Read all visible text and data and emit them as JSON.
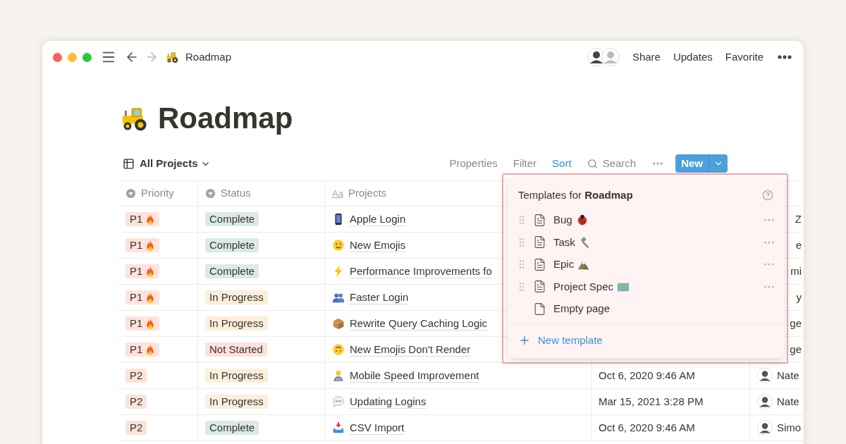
{
  "titlebar": {
    "breadcrumb": "Roadmap",
    "actions": [
      "Share",
      "Updates",
      "Favorite"
    ]
  },
  "page": {
    "title": "Roadmap"
  },
  "view": {
    "name": "All Projects",
    "tools": [
      {
        "label": "Properties",
        "selected": false
      },
      {
        "label": "Filter",
        "selected": false
      },
      {
        "label": "Sort",
        "selected": true
      }
    ],
    "search": "Search",
    "new_button": "New"
  },
  "table": {
    "columns": [
      {
        "label": "Priority",
        "kind": "select"
      },
      {
        "label": "Status",
        "kind": "select"
      },
      {
        "label": "Projects",
        "kind": "title",
        "glyph": "Aa"
      }
    ],
    "rows": [
      {
        "priority": {
          "label": "P1",
          "urgent": true,
          "color": "#ffe2dd"
        },
        "status": {
          "label": "Complete",
          "color": "#dbe9e8"
        },
        "project": "Apple Login",
        "person": "Z"
      },
      {
        "priority": {
          "label": "P1",
          "urgent": true,
          "color": "#ffe2dd"
        },
        "status": {
          "label": "Complete",
          "color": "#dbe9e8"
        },
        "project": "New Emojis",
        "person": "e"
      },
      {
        "priority": {
          "label": "P1",
          "urgent": true,
          "color": "#ffe2dd"
        },
        "status": {
          "label": "Complete",
          "color": "#dbe9e8"
        },
        "project": "Performance Improvements fo",
        "person": "mi"
      },
      {
        "priority": {
          "label": "P1",
          "urgent": true,
          "color": "#ffe2dd"
        },
        "status": {
          "label": "In Progress",
          "color": "#fbeedb"
        },
        "project": "Faster Login",
        "person": "y"
      },
      {
        "priority": {
          "label": "P1",
          "urgent": true,
          "color": "#ffe2dd"
        },
        "status": {
          "label": "In Progress",
          "color": "#fbeedb"
        },
        "project": "Rewrite Query Caching Logic",
        "person": "ge"
      },
      {
        "priority": {
          "label": "P1",
          "urgent": true,
          "color": "#ffe2dd"
        },
        "status": {
          "label": "Not Started",
          "color": "#ffe2dd"
        },
        "project": "New Emojis Don't Render",
        "person": "ge"
      },
      {
        "priority": {
          "label": "P2",
          "urgent": false,
          "color": "#fbe4d7"
        },
        "status": {
          "label": "In Progress",
          "color": "#fbeedb"
        },
        "project": "Mobile Speed Improvement",
        "date": "Oct 6, 2020 9:46 AM",
        "person": "Nate"
      },
      {
        "priority": {
          "label": "P2",
          "urgent": false,
          "color": "#fbe4d7"
        },
        "status": {
          "label": "In Progress",
          "color": "#fbeedb"
        },
        "project": "Updating Logins",
        "date": "Mar 15, 2021 3:28 PM",
        "person": "Nate"
      },
      {
        "priority": {
          "label": "P2",
          "urgent": false,
          "color": "#fbe4d7"
        },
        "status": {
          "label": "Complete",
          "color": "#dbe9e8"
        },
        "project": "CSV Import",
        "date": "Oct 6, 2020 9:46 AM",
        "person": "Simo"
      }
    ]
  },
  "templates_menu": {
    "title": "Templates for **Roadmap**",
    "items": [
      {
        "label": "Bug",
        "kind": "template"
      },
      {
        "label": "Task",
        "kind": "template"
      },
      {
        "label": "Epic",
        "kind": "template"
      },
      {
        "label": "Project Spec",
        "kind": "template"
      },
      {
        "label": "Empty page",
        "kind": "blank"
      }
    ],
    "new_template": "New template"
  }
}
